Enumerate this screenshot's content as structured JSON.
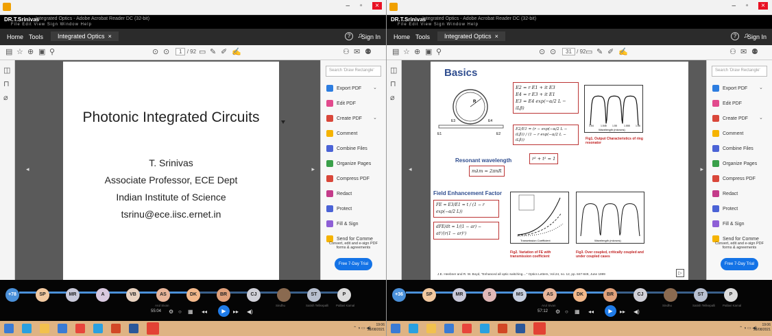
{
  "left": {
    "presenter": "DR.T.Srinivas",
    "window_title": "Integrated Optics - Adobe Acrobat Reader DC (32-bit)",
    "menu": "File  Edit  View  Sign  Window  Help",
    "tabs": {
      "home": "Home",
      "tools": "Tools",
      "doc": "Integrated Optics",
      "close": "×"
    },
    "signin": "Sign In",
    "page_current": "1",
    "page_total": "/ 92",
    "slide": {
      "title": "Photonic Integrated Circuits",
      "author": "T. Srinivas",
      "role": "Associate Professor, ECE Dept",
      "institute": "Indian Institute of Science",
      "email": "tsrinu@ece.iisc.ernet.in"
    },
    "timecode": "55:04"
  },
  "right": {
    "presenter": "DR.T.Srinivas",
    "window_title": "Integrated Optics - Adobe Acrobat Reader DC (32-bit)",
    "menu": "File  Edit  View  Sign  Window  Help",
    "tabs": {
      "home": "Home",
      "tools": "Tools",
      "doc": "Integrated Optics",
      "close": "×"
    },
    "signin": "Sign In",
    "page_current": "31",
    "page_total": "/ 92",
    "slide": {
      "heading": "Basics",
      "resonant": "Resonant wavelength",
      "resonant_eq": "mλm = 2πnR",
      "rt_eq": "r² + t² = 1",
      "field_factor": "Field Enhancement Factor",
      "eq1": "E2 = r E1 + it E3",
      "eq2": "E4 = r E3 + it E1",
      "eq3": "E3 = E4 exp(−α/2 L − iLβ)",
      "eq4": "E2/E1 = (r − exp(−α/2 L − iLβ)) / (1 − r exp(−α/2 L − iLβ))",
      "fe_eq": "FE = E3/E1 = t / (1 − r exp(−α/2 L))",
      "dfe_eq": "dFE/dt = 1/(1 − ar) − at²/(r(1 − ar)²)",
      "ring_R": "R",
      "ring_E1": "E1",
      "ring_E2": "E2",
      "ring_E3": "E3",
      "ring_E4": "E4",
      "fig1": "Fig1. Output Characteristics of ring resonator",
      "fig2": "Fig2. Variation of FE with transmission coefficient",
      "fig3": "Fig3. Over coupled, critically coupled and under coupled cases",
      "fig1_xticks": [
        "1.54",
        "1.545",
        "1.55",
        "1.555",
        "1.56"
      ],
      "fig1_xlabel": "Wavelength (microns)",
      "fig2_xlabel": "Transmission Coefficient",
      "fig3_xlabel": "Wavelength (microns)",
      "reference": "J.E. Heebner and R. W. Boyd, \"Enhanced all optic switching....\" Optics Letters, Vol.24, no. 12, pp. 847-849, June 1999"
    },
    "timecode": "57:12"
  },
  "tools": {
    "search_placeholder": "Search 'Draw Rectangle'",
    "items": [
      {
        "label": "Export PDF",
        "color": "#2d7de0",
        "chevron": true
      },
      {
        "label": "Edit PDF",
        "color": "#e24a8d"
      },
      {
        "label": "Create PDF",
        "color": "#d9473a",
        "chevron": true
      },
      {
        "label": "Comment",
        "color": "#f5b301"
      },
      {
        "label": "Combine Files",
        "color": "#4b63d6"
      },
      {
        "label": "Organize Pages",
        "color": "#3aa04a"
      },
      {
        "label": "Compress PDF",
        "color": "#d9473a"
      },
      {
        "label": "Redact",
        "color": "#c43b8a"
      },
      {
        "label": "Protect",
        "color": "#4b63d6"
      },
      {
        "label": "Fill & Sign",
        "color": "#8e5fd6"
      },
      {
        "label": "Send for Comme",
        "color": "#f5b301"
      }
    ],
    "note": "Convert, edit and e-sign PDF forms & agreements",
    "trial": "Free 7-Day Trial"
  },
  "participants": {
    "left": [
      {
        "label": "+78",
        "color": "#4a90d9"
      },
      {
        "label": "SP",
        "color": "#f2c9a0"
      },
      {
        "label": "MR",
        "color": "#c9c9d9"
      },
      {
        "label": "A",
        "color": "#d9c9e0"
      },
      {
        "label": "VB",
        "color": "#e8d2c0"
      },
      {
        "label": "AS",
        "color": "#e8b59a",
        "name": "Arul Sivan"
      },
      {
        "label": "DK",
        "color": "#f2b88a"
      },
      {
        "label": "BR",
        "color": "#e0a07a"
      },
      {
        "label": "CJ",
        "color": "#d0d0d8"
      },
      {
        "label": "",
        "color": "#8a6a50",
        "name": "Sindhu"
      },
      {
        "label": "ST",
        "color": "#b8c0d0",
        "name": "Satish Telikepalli"
      },
      {
        "label": "P",
        "color": "#dcdcdc",
        "name": "Pallavi Kamal"
      }
    ],
    "right": [
      {
        "label": "+36",
        "color": "#4a90d9"
      },
      {
        "label": "SP",
        "color": "#f2c9a0"
      },
      {
        "label": "MR",
        "color": "#c9c9d9"
      },
      {
        "label": "S",
        "color": "#e0b8b8"
      },
      {
        "label": "MS",
        "color": "#c8d0e0"
      },
      {
        "label": "AS",
        "color": "#e8b59a",
        "name": "Arul Sivan"
      },
      {
        "label": "DK",
        "color": "#f2b88a"
      },
      {
        "label": "BR",
        "color": "#e0a07a"
      },
      {
        "label": "CJ",
        "color": "#d0d0d8"
      },
      {
        "label": "",
        "color": "#8a6a50",
        "name": "Sindhu"
      },
      {
        "label": "ST",
        "color": "#b8c0d0",
        "name": "Satish Telikepalli"
      },
      {
        "label": "P",
        "color": "#dcdcdc",
        "name": "Pallavi Kamal"
      }
    ]
  },
  "taskbar": {
    "icons": [
      {
        "name": "start-icon",
        "color": "#3a7bd5"
      },
      {
        "name": "ie-icon",
        "color": "#2aa0e0"
      },
      {
        "name": "explorer-icon",
        "color": "#f2c14e"
      },
      {
        "name": "store-icon",
        "color": "#3a7bd5"
      },
      {
        "name": "chrome-icon",
        "color": "#e8453c"
      },
      {
        "name": "edge-icon",
        "color": "#2aa0e0"
      },
      {
        "name": "powerpoint-icon",
        "color": "#d24726"
      },
      {
        "name": "word-icon",
        "color": "#2b579a"
      },
      {
        "name": "acrobat-icon",
        "color": "#e34234"
      }
    ],
    "clock_time": "19:06",
    "clock_date": "25/08/2021"
  }
}
